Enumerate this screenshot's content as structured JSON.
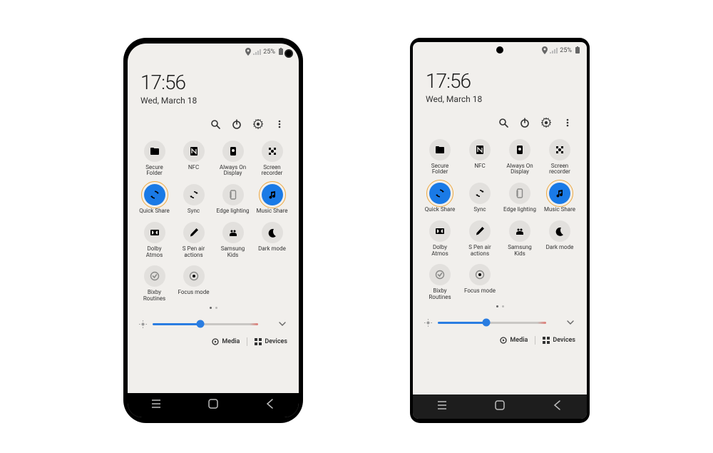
{
  "status": {
    "battery_pct": "25%"
  },
  "header": {
    "time": "17:56",
    "date": "Wed, March 18"
  },
  "tiles": {
    "secure_folder": "Secure\nFolder",
    "nfc": "NFC",
    "aod": "Always On\nDisplay",
    "screen_recorder": "Screen\nrecorder",
    "quick_share": "Quick Share",
    "sync": "Sync",
    "edge_lighting": "Edge lighting",
    "music_share": "Music Share",
    "dolby": "Dolby\nAtmos",
    "spen": "S Pen air\nactions",
    "kids": "Samsung\nKids",
    "dark_mode": "Dark mode",
    "bixby": "Bixby\nRoutines",
    "focus": "Focus mode"
  },
  "bottombar": {
    "media": "Media",
    "devices": "Devices"
  },
  "colors": {
    "accent": "#1a7ae6",
    "highlight": "#f0a93e"
  }
}
